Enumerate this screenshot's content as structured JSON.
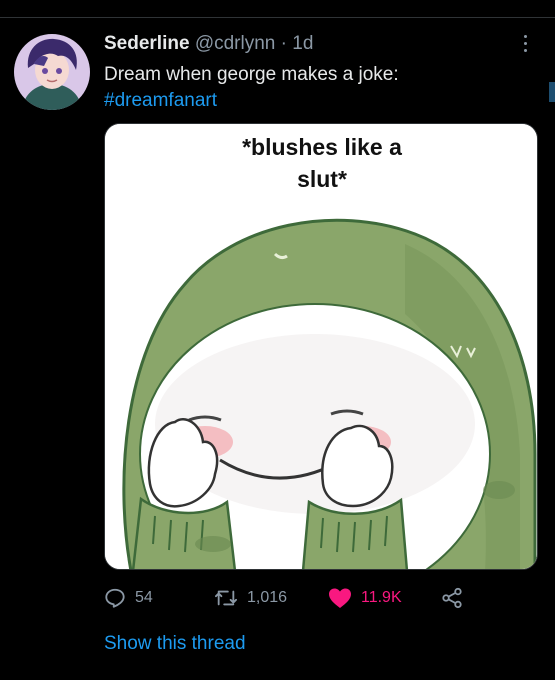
{
  "tweet": {
    "author_name": "Sederline",
    "author_handle": "@cdrlynn",
    "separator": " · ",
    "age": "1d",
    "text": "Dream when george makes a joke:",
    "hashtag": "#dreamfanart"
  },
  "media": {
    "caption_line1": "*blushes like a",
    "caption_line2": "slut*"
  },
  "actions": {
    "reply_count": "54",
    "retweet_count": "1,016",
    "like_count": "11.9K"
  },
  "show_thread_label": "Show this thread",
  "icons": {
    "more": "more-icon",
    "reply": "reply-icon",
    "retweet": "retweet-icon",
    "like": "heart-icon",
    "share": "share-icon"
  },
  "colors": {
    "background": "#000000",
    "text": "#e7e9ea",
    "muted": "#8b98a5",
    "link": "#1d9bf0",
    "like": "#f91880",
    "hood": "#8aa66a"
  }
}
